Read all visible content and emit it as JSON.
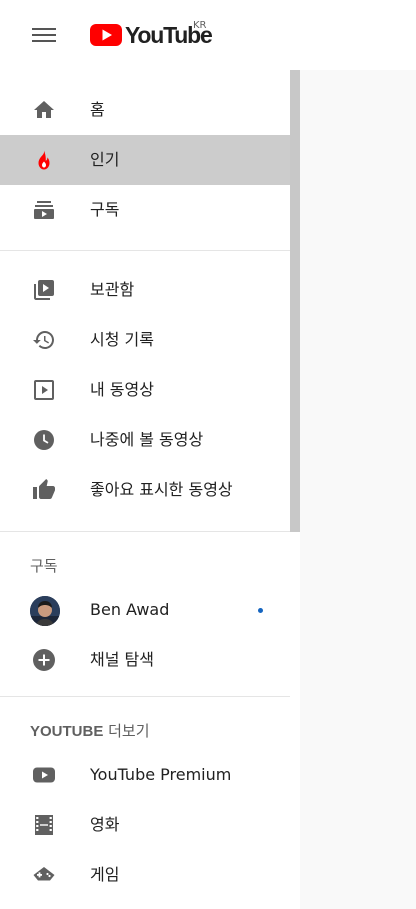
{
  "header": {
    "logo_text": "YouTube",
    "country_code": "KR",
    "accent_color": "#ff0000"
  },
  "nav_main": [
    {
      "label": "홈",
      "icon": "home-icon"
    },
    {
      "label": "인기",
      "icon": "trending-icon",
      "active": true
    },
    {
      "label": "구독",
      "icon": "subscriptions-icon"
    }
  ],
  "nav_library": [
    {
      "label": "보관함",
      "icon": "library-icon"
    },
    {
      "label": "시청 기록",
      "icon": "history-icon"
    },
    {
      "label": "내 동영상",
      "icon": "my-videos-icon"
    },
    {
      "label": "나중에 볼 동영상",
      "icon": "watch-later-icon"
    },
    {
      "label": "좋아요 표시한 동영상",
      "icon": "liked-videos-icon"
    }
  ],
  "subscriptions": {
    "title": "구독",
    "channels": [
      {
        "name": "Ben Awad",
        "has_new": true,
        "icon": "avatar"
      }
    ],
    "browse_label": "채널 탐색"
  },
  "more_section": {
    "title_brand": "YOUTUBE",
    "title_suffix": " 더보기",
    "items": [
      {
        "label": "YouTube Premium",
        "icon": "youtube-premium-icon"
      },
      {
        "label": "영화",
        "icon": "movies-icon"
      },
      {
        "label": "게임",
        "icon": "gaming-icon"
      }
    ]
  }
}
